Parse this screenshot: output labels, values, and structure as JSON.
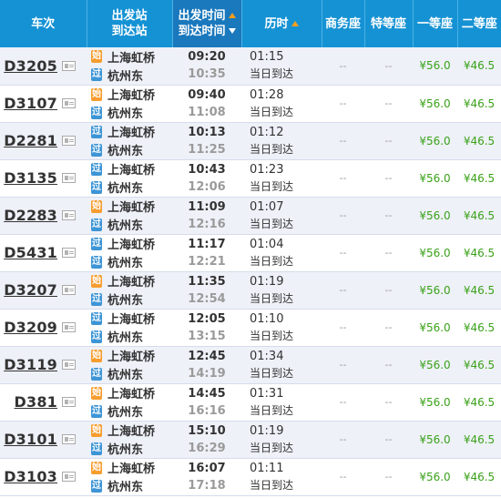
{
  "header": {
    "train_no": "车次",
    "stations_line1": "出发站",
    "stations_line2": "到达站",
    "times_line1": "出发时间",
    "times_line2": "到达时间",
    "duration": "历时",
    "business_seat": "商务座",
    "special_seat": "特等座",
    "first_class": "一等座",
    "second_class": "二等座"
  },
  "rows": [
    {
      "train": "D3205",
      "start_badge": "始",
      "from": "上海虹桥",
      "pass_badge": "过",
      "to": "杭州东",
      "depart": "09:20",
      "arrive": "10:35",
      "duration": "01:15",
      "arrive_note": "当日到达",
      "business": "--",
      "special": "--",
      "first": "¥56.0",
      "second": "¥46.5"
    },
    {
      "train": "D3107",
      "start_badge": "始",
      "from": "上海虹桥",
      "pass_badge": "过",
      "to": "杭州东",
      "depart": "09:40",
      "arrive": "11:08",
      "duration": "01:28",
      "arrive_note": "当日到达",
      "business": "--",
      "special": "--",
      "first": "¥56.0",
      "second": "¥46.5"
    },
    {
      "train": "D2281",
      "start_badge": "过",
      "from": "上海虹桥",
      "pass_badge": "过",
      "to": "杭州东",
      "depart": "10:13",
      "arrive": "11:25",
      "duration": "01:12",
      "arrive_note": "当日到达",
      "business": "--",
      "special": "--",
      "first": "¥56.0",
      "second": "¥46.5"
    },
    {
      "train": "D3135",
      "start_badge": "过",
      "from": "上海虹桥",
      "pass_badge": "过",
      "to": "杭州东",
      "depart": "10:43",
      "arrive": "12:06",
      "duration": "01:23",
      "arrive_note": "当日到达",
      "business": "--",
      "special": "--",
      "first": "¥56.0",
      "second": "¥46.5"
    },
    {
      "train": "D2283",
      "start_badge": "始",
      "from": "上海虹桥",
      "pass_badge": "过",
      "to": "杭州东",
      "depart": "11:09",
      "arrive": "12:16",
      "duration": "01:07",
      "arrive_note": "当日到达",
      "business": "--",
      "special": "--",
      "first": "¥56.0",
      "second": "¥46.5"
    },
    {
      "train": "D5431",
      "start_badge": "过",
      "from": "上海虹桥",
      "pass_badge": "过",
      "to": "杭州东",
      "depart": "11:17",
      "arrive": "12:21",
      "duration": "01:04",
      "arrive_note": "当日到达",
      "business": "--",
      "special": "--",
      "first": "¥56.0",
      "second": "¥46.5"
    },
    {
      "train": "D3207",
      "start_badge": "始",
      "from": "上海虹桥",
      "pass_badge": "过",
      "to": "杭州东",
      "depart": "11:35",
      "arrive": "12:54",
      "duration": "01:19",
      "arrive_note": "当日到达",
      "business": "--",
      "special": "--",
      "first": "¥56.0",
      "second": "¥46.5"
    },
    {
      "train": "D3209",
      "start_badge": "过",
      "from": "上海虹桥",
      "pass_badge": "过",
      "to": "杭州东",
      "depart": "12:05",
      "arrive": "13:15",
      "duration": "01:10",
      "arrive_note": "当日到达",
      "business": "--",
      "special": "--",
      "first": "¥56.0",
      "second": "¥46.5"
    },
    {
      "train": "D3119",
      "start_badge": "始",
      "from": "上海虹桥",
      "pass_badge": "过",
      "to": "杭州东",
      "depart": "12:45",
      "arrive": "14:19",
      "duration": "01:34",
      "arrive_note": "当日到达",
      "business": "--",
      "special": "--",
      "first": "¥56.0",
      "second": "¥46.5"
    },
    {
      "train": "D381",
      "start_badge": "始",
      "from": "上海虹桥",
      "pass_badge": "过",
      "to": "杭州东",
      "depart": "14:45",
      "arrive": "16:16",
      "duration": "01:31",
      "arrive_note": "当日到达",
      "business": "--",
      "special": "--",
      "first": "¥56.0",
      "second": "¥46.5"
    },
    {
      "train": "D3101",
      "start_badge": "始",
      "from": "上海虹桥",
      "pass_badge": "过",
      "to": "杭州东",
      "depart": "15:10",
      "arrive": "16:29",
      "duration": "01:19",
      "arrive_note": "当日到达",
      "business": "--",
      "special": "--",
      "first": "¥56.0",
      "second": "¥46.5"
    },
    {
      "train": "D3103",
      "start_badge": "始",
      "from": "上海虹桥",
      "pass_badge": "过",
      "to": "杭州东",
      "depart": "16:07",
      "arrive": "17:18",
      "duration": "01:11",
      "arrive_note": "当日到达",
      "business": "--",
      "special": "--",
      "first": "¥56.0",
      "second": "¥46.5"
    }
  ]
}
